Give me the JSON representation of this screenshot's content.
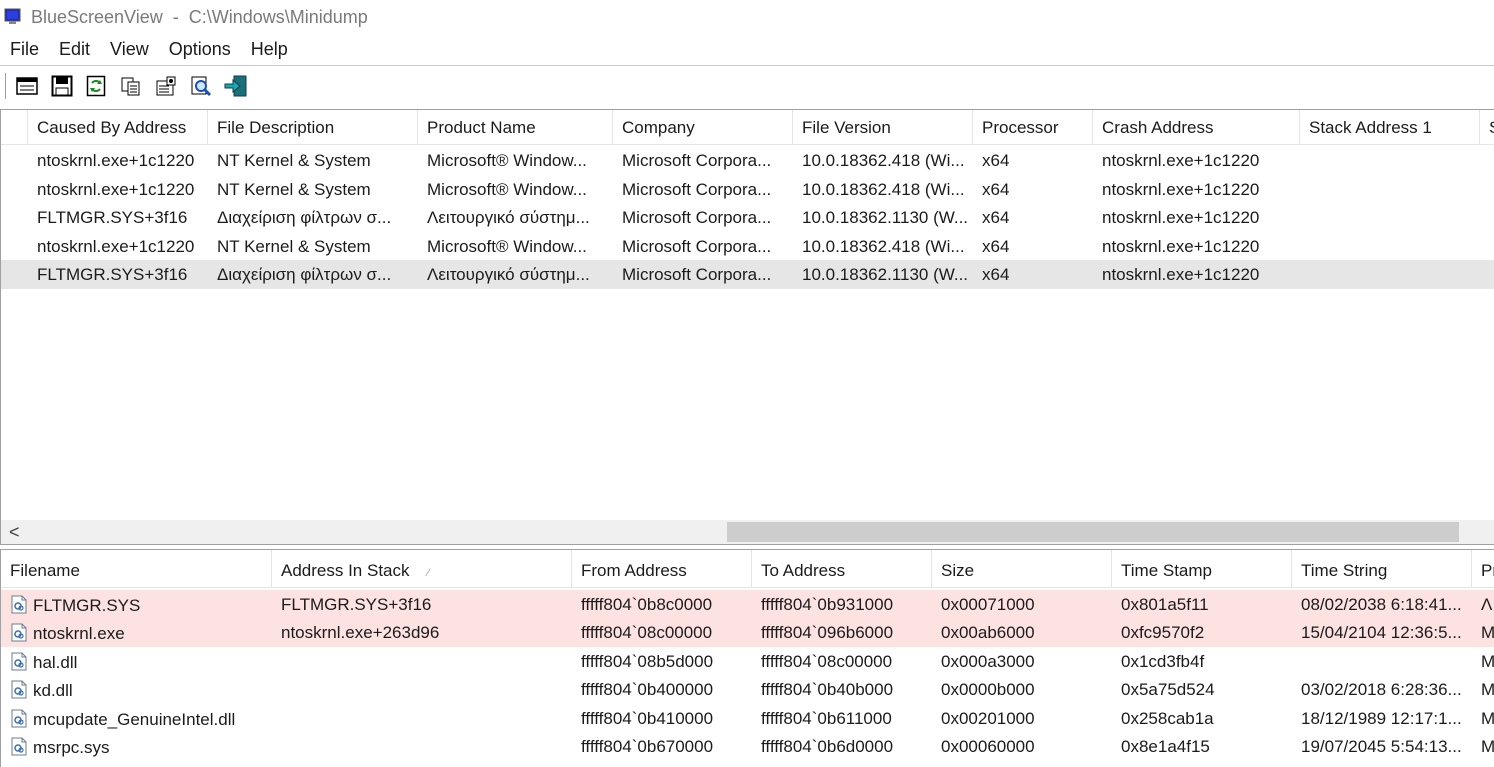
{
  "window": {
    "app_name": "BlueScreenView",
    "title_separator": "  -  ",
    "path": "C:\\Windows\\Minidump",
    "app_icon": "monitor-icon"
  },
  "menu": [
    "File",
    "Edit",
    "View",
    "Options",
    "Help"
  ],
  "toolbar": [
    {
      "name": "html-report-icon"
    },
    {
      "name": "save-icon"
    },
    {
      "name": "refresh-icon"
    },
    {
      "name": "copy-icon"
    },
    {
      "name": "properties-icon"
    },
    {
      "name": "find-icon"
    },
    {
      "name": "exit-icon"
    }
  ],
  "crash_list": {
    "columns": [
      "Caused By Address",
      "File Description",
      "Product Name",
      "Company",
      "File Version",
      "Processor",
      "Crash Address",
      "Stack Address 1",
      "S"
    ],
    "rows": [
      [
        "ntoskrnl.exe+1c1220",
        "NT Kernel & System",
        "Microsoft® Window...",
        "Microsoft Corpora...",
        "10.0.18362.418 (Wi...",
        "x64",
        "ntoskrnl.exe+1c1220",
        "",
        ""
      ],
      [
        "ntoskrnl.exe+1c1220",
        "NT Kernel & System",
        "Microsoft® Window...",
        "Microsoft Corpora...",
        "10.0.18362.418 (Wi...",
        "x64",
        "ntoskrnl.exe+1c1220",
        "",
        ""
      ],
      [
        "FLTMGR.SYS+3f16",
        "Διαχείριση φίλτρων σ...",
        "Λειτουργικό σύστημ...",
        "Microsoft Corpora...",
        "10.0.18362.1130 (W...",
        "x64",
        "ntoskrnl.exe+1c1220",
        "",
        ""
      ],
      [
        "ntoskrnl.exe+1c1220",
        "NT Kernel & System",
        "Microsoft® Window...",
        "Microsoft Corpora...",
        "10.0.18362.418 (Wi...",
        "x64",
        "ntoskrnl.exe+1c1220",
        "",
        ""
      ],
      [
        "FLTMGR.SYS+3f16",
        "Διαχείριση φίλτρων σ...",
        "Λειτουργικό σύστημ...",
        "Microsoft Corpora...",
        "10.0.18362.1130 (W...",
        "x64",
        "ntoskrnl.exe+1c1220",
        "",
        ""
      ]
    ],
    "selected_row": 4,
    "scroll_left_glyph": "<"
  },
  "driver_list": {
    "columns": [
      "Filename",
      "Address In Stack",
      "From Address",
      "To Address",
      "Size",
      "Time Stamp",
      "Time String",
      "Pr"
    ],
    "sort_glyph": "⁄",
    "rows": [
      [
        "FLTMGR.SYS",
        "FLTMGR.SYS+3f16",
        "fffff804`0b8c0000",
        "fffff804`0b931000",
        "0x00071000",
        "0x801a5f11",
        "08/02/2038 6:18:41...",
        "Λ"
      ],
      [
        "ntoskrnl.exe",
        "ntoskrnl.exe+263d96",
        "fffff804`08c00000",
        "fffff804`096b6000",
        "0x00ab6000",
        "0xfc9570f2",
        "15/04/2104 12:36:5...",
        "M"
      ],
      [
        "hal.dll",
        "",
        "fffff804`08b5d000",
        "fffff804`08c00000",
        "0x000a3000",
        "0x1cd3fb4f",
        "",
        "M"
      ],
      [
        "kd.dll",
        "",
        "fffff804`0b400000",
        "fffff804`0b40b000",
        "0x0000b000",
        "0x5a75d524",
        "03/02/2018 6:28:36...",
        "M"
      ],
      [
        "mcupdate_GenuineIntel.dll",
        "",
        "fffff804`0b410000",
        "fffff804`0b611000",
        "0x00201000",
        "0x258cab1a",
        "18/12/1989 12:17:1...",
        "M"
      ],
      [
        "msrpc.sys",
        "",
        "fffff804`0b670000",
        "fffff804`0b6d0000",
        "0x00060000",
        "0x8e1a4f15",
        "19/07/2045 5:54:13...",
        "M"
      ]
    ],
    "highlighted_rows": [
      0,
      1
    ],
    "file_icon": "dll-file-icon"
  },
  "colors": {
    "highlight_pink": "#fde2e2",
    "selected_gray": "#e6e6e6"
  }
}
